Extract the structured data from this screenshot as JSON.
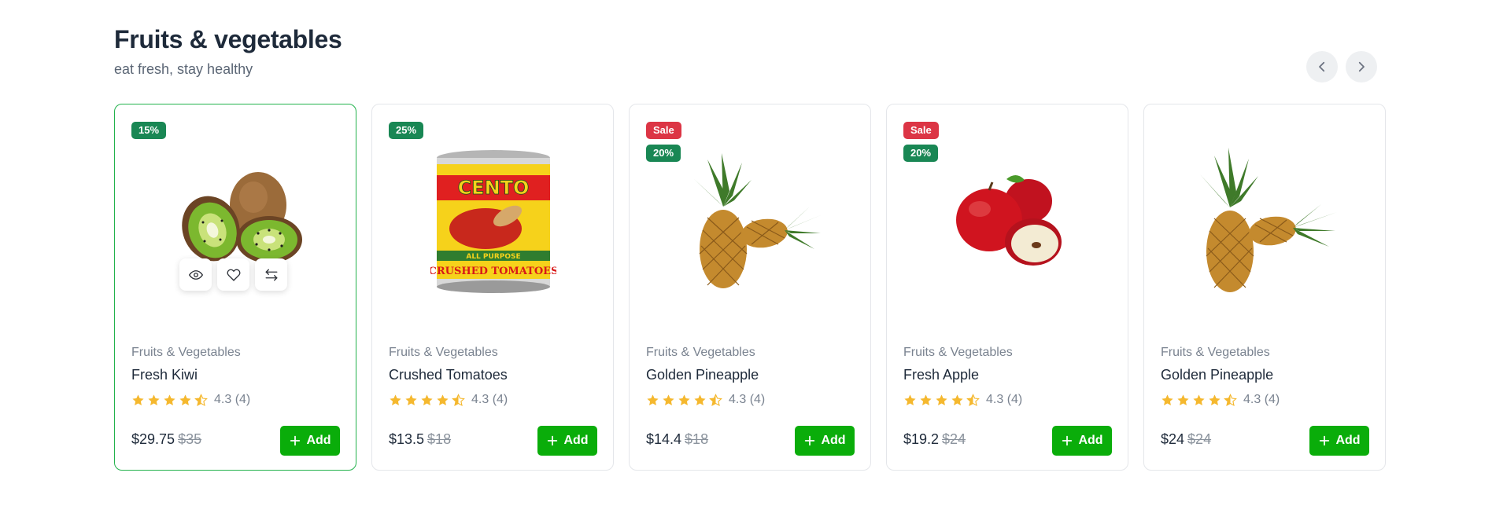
{
  "section": {
    "title": "Fruits & vegetables",
    "subtitle": "eat fresh, stay healthy"
  },
  "nav": {
    "prev_icon": "chevron-left-icon",
    "next_icon": "chevron-right-icon"
  },
  "colors": {
    "accent": "#0aad0a",
    "discount_badge": "#198754",
    "sale_badge": "#dc3545",
    "star": "#f5b82e"
  },
  "products": [
    {
      "sale": "",
      "discount": "15%",
      "category": "Fruits & Vegetables",
      "name": "Fresh Kiwi",
      "rating": "4.3 (4)",
      "price": "$29.75",
      "old_price": "$35",
      "add_label": "Add",
      "image": "kiwi"
    },
    {
      "sale": "",
      "discount": "25%",
      "category": "Fruits & Vegetables",
      "name": "Crushed Tomatoes",
      "rating": "4.3 (4)",
      "price": "$13.5",
      "old_price": "$18",
      "add_label": "Add",
      "image": "tomato-can",
      "can_brand": "CENTO",
      "can_band": "ALL PURPOSE",
      "can_label": "CRUSHED TOMATOES"
    },
    {
      "sale": "Sale",
      "discount": "20%",
      "category": "Fruits & Vegetables",
      "name": "Golden Pineapple",
      "rating": "4.3 (4)",
      "price": "$14.4",
      "old_price": "$18",
      "add_label": "Add",
      "image": "pineapple"
    },
    {
      "sale": "Sale",
      "discount": "20%",
      "category": "Fruits & Vegetables",
      "name": "Fresh Apple",
      "rating": "4.3 (4)",
      "price": "$19.2",
      "old_price": "$24",
      "add_label": "Add",
      "image": "apple"
    },
    {
      "sale": "",
      "discount": "",
      "category": "Fruits & Vegetables",
      "name": "Golden Pineapple",
      "rating": "4.3 (4)",
      "price": "$24",
      "old_price": "$24",
      "add_label": "Add",
      "image": "pineapple"
    }
  ],
  "quick_actions": [
    "eye-icon",
    "heart-icon",
    "compare-icon"
  ]
}
